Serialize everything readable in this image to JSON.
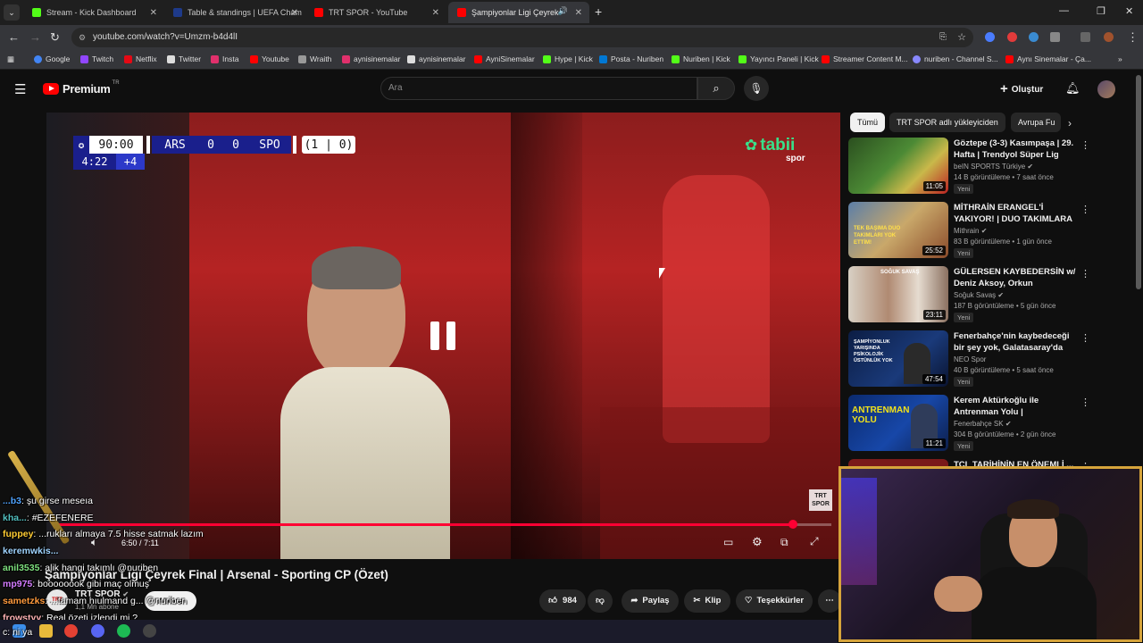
{
  "browser": {
    "tabs": [
      {
        "title": "Stream - Kick Dashboard",
        "color": "#53fc18"
      },
      {
        "title": "Table & standings | UEFA Cham",
        "color": "#1e3a8a"
      },
      {
        "title": "TRT SPOR - YouTube",
        "color": "#ff0000"
      },
      {
        "title": "Şampiyonlar Ligi Çeyrek Fin",
        "color": "#ff0000"
      }
    ],
    "url": "youtube.com/watch?v=Umzm-b4d4lI",
    "bookmarks": [
      {
        "label": "Google",
        "color": "#4285f4"
      },
      {
        "label": "Twitch",
        "color": "#9146ff"
      },
      {
        "label": "Netflix",
        "color": "#e50914"
      },
      {
        "label": "Twitter",
        "color": "#ffffff"
      },
      {
        "label": "Insta",
        "color": "#e1306c"
      },
      {
        "label": "Youtube",
        "color": "#ff0000"
      },
      {
        "label": "Wraith",
        "color": "#cccccc"
      },
      {
        "label": "aynisinemalar",
        "color": "#e1306c"
      },
      {
        "label": "aynisinemalar",
        "color": "#ffffff"
      },
      {
        "label": "AyniSinemalar",
        "color": "#ff0000"
      },
      {
        "label": "Hype | Kick",
        "color": "#53fc18"
      },
      {
        "label": "Posta - Nuriben",
        "color": "#0078d4"
      },
      {
        "label": "Nuriben | Kick",
        "color": "#53fc18"
      },
      {
        "label": "Yayıncı Paneli | Kick",
        "color": "#53fc18"
      },
      {
        "label": "Streamer Content M...",
        "color": "#ff0000"
      },
      {
        "label": "nuriben - Channel S...",
        "color": "#8888ff"
      },
      {
        "label": "Aynı Sinemalar - Ça...",
        "color": "#ff0000"
      }
    ]
  },
  "youtube": {
    "logo": "Premium",
    "logo_sup": "TR",
    "search_placeholder": "Ara",
    "create_label": "Oluştur"
  },
  "video": {
    "title": "Şampiyonlar Ligi Çeyrek Final | Arsenal - Sporting CP (Özet)",
    "channel": "TRT SPOR",
    "subscribers": "1,1 Mn abone",
    "time": "6:50 / 7:11",
    "progress": 0.951,
    "likes": "984",
    "share_label": "Paylaş",
    "clip_label": "Klip",
    "thanks_label": "Teşekkürler",
    "subscribe_label": "Abone",
    "watermark": "TRT",
    "watermark_sub": "SPOR",
    "brand": "tabii",
    "brand_sub": "spor",
    "scoreboard": {
      "clock": "90:00",
      "home": "ARS",
      "home_score": "0",
      "away_score": "0",
      "away": "SPO",
      "aggregate": "(1 | 0)",
      "stoppage_time": "4:22",
      "added": "+4"
    }
  },
  "filters": [
    "Tümü",
    "TRT SPOR adlı yükleyiciden",
    "Avrupa Fu"
  ],
  "recommendations": [
    {
      "title": "Göztepe (3-3) Kasımpaşa | 29. Hafta | Trendyol Süper Lig 202...",
      "channel": "beIN SPORTS Türkiye",
      "meta": "14 B görüntüleme • 7 saat önce",
      "badge": "Yeni",
      "duration": "11:05"
    },
    {
      "title": "MİTHRAİN ERANGEL'İ YAKIYOR! | DUO TAKIMLARA KARŞI TEK ...",
      "channel": "Mithrain",
      "meta": "83 B görüntüleme • 1 gün önce",
      "badge": "Yeni",
      "duration": "25:52"
    },
    {
      "title": "GÜLERSEN KAYBEDERSİN w/ Deniz Aksoy, Orkun Çolakoğlu,...",
      "channel": "Soğuk Savaş",
      "meta": "187 B görüntüleme • 5 gün önce",
      "badge": "Yeni",
      "duration": "23:11"
    },
    {
      "title": "Fenerbahçe'nin kaybedeceği bir şey yok, Galatasaray'da Latin ...",
      "channel": "NEO Spor",
      "meta": "40 B görüntüleme • 5 saat önce",
      "badge": "Yeni",
      "duration": "47:54"
    },
    {
      "title": "Kerem Aktürkoğlu ile Antrenman Yolu | Kariyerimde...",
      "channel": "Fenerbahçe SK",
      "meta": "304 B görüntüleme • 2 gün önce",
      "badge": "Yeni",
      "duration": "11:21"
    },
    {
      "title": "TCL TARİHİNİN EN ÖNEMLİ ...",
      "channel": "",
      "meta": "",
      "badge": "",
      "duration": ""
    }
  ],
  "thumb_texts": [
    "TEK BAŞIMA DUO TAKIMLARI YOK ETTİM!",
    "SOĞUK SAVAŞ",
    "ŞAMPİYONLUK YARIŞINDA PSİKOLOJİK ÜSTÜNLÜK YOK",
    "ANTRENMAN YOLU"
  ],
  "chat": [
    {
      "user": "...b3",
      "color": "#4fa3ff",
      "msg": ": şu girse meseıa"
    },
    {
      "user": "kha...",
      "color": "#53c0c0",
      "msg": ": #EZEFENERE"
    },
    {
      "user": "fuppey",
      "color": "#ffcc33",
      "msg": ": ...rukları almaya 7.5 hisse satmak lazım"
    },
    {
      "user": "keremwkis...",
      "color": "#9fd4ff",
      "msg": ""
    },
    {
      "user": "anil3535",
      "color": "#7ee07e",
      "msg": ": alik hangi takımlı @nuriben"
    },
    {
      "user": "mp975",
      "color": "#d47cff",
      "msg": ": boooooook gibi maç olmuş"
    },
    {
      "user": "sametzks",
      "color": "#ff9a3c",
      "msg": ": ...tamam hıulmand g... @nuriben"
    },
    {
      "user": "frowstyy",
      "color": "#ffb3b3",
      "msg": ": Real özeti izlendi mi ?"
    },
    {
      "user": "",
      "color": "#ffffff",
      "msg": "c: ni ya"
    }
  ]
}
